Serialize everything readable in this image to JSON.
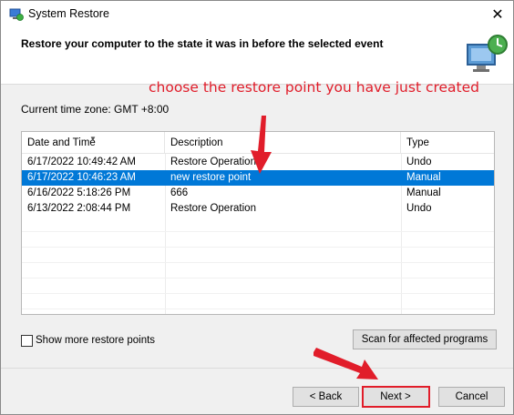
{
  "window": {
    "title": "System Restore",
    "close_glyph": "✕"
  },
  "header": {
    "title": "Restore your computer to the state it was in before the selected event",
    "icon": "system-restore-icon"
  },
  "annotation": {
    "text": "choose the restore point you have just created",
    "color": "#e11d2a"
  },
  "timezone": {
    "label": "Current time zone: GMT +8:00"
  },
  "list": {
    "columns": [
      "Date and Time",
      "Description",
      "Type"
    ],
    "rows": [
      {
        "date": "6/17/2022 10:49:42 AM",
        "description": "Restore Operation",
        "type": "Undo",
        "selected": false
      },
      {
        "date": "6/17/2022 10:46:23 AM",
        "description": "new restore point",
        "type": "Manual",
        "selected": true
      },
      {
        "date": "6/16/2022 5:18:26 PM",
        "description": "666",
        "type": "Manual",
        "selected": false
      },
      {
        "date": "6/13/2022 2:08:44 PM",
        "description": "Restore Operation",
        "type": "Undo",
        "selected": false
      }
    ],
    "selection_color": "#0078d7"
  },
  "options": {
    "show_more_label": "Show more restore points",
    "show_more_checked": false
  },
  "buttons": {
    "scan": "Scan for affected programs",
    "back": "< Back",
    "next": "Next >",
    "cancel": "Cancel"
  }
}
